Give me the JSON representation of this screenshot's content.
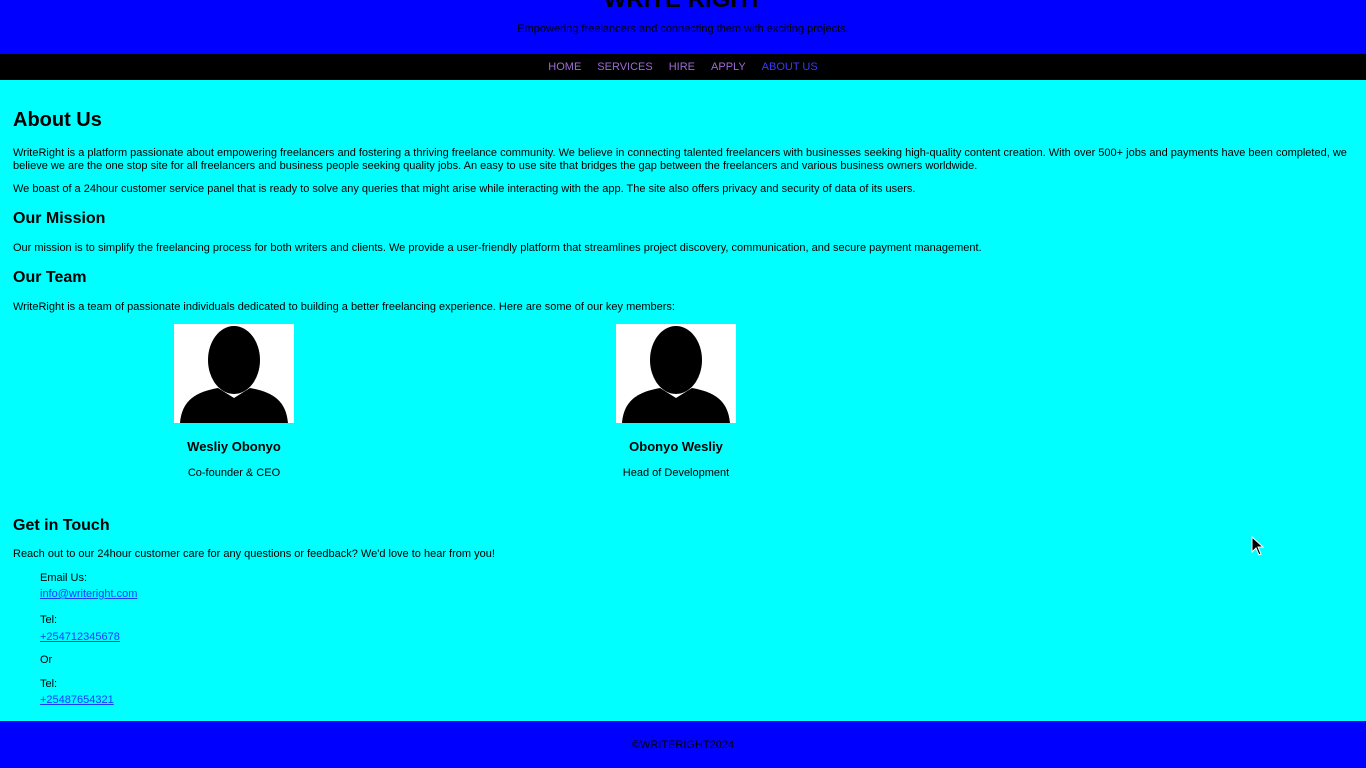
{
  "header": {
    "title": "WRITE RIGHT",
    "tagline": "Empowering freelancers and connecting them with exciting projects."
  },
  "nav": {
    "items": [
      {
        "label": "HOME"
      },
      {
        "label": "SERVICES"
      },
      {
        "label": "HIRE"
      },
      {
        "label": "APPLY"
      },
      {
        "label": "ABOUT US",
        "active": true
      }
    ]
  },
  "about": {
    "title": "About Us",
    "p1": "WriteRight is a platform passionate about empowering freelancers and fostering a thriving freelance community. We believe in connecting talented freelancers with businesses seeking high-quality content creation. With over 500+ jobs and payments have been completed, we believe we are the one stop site for all freelancers and business people seeking quality jobs. An easy to use site that bridges the gap between the freelancers and various business owners worldwide.",
    "p2": "We boast of a 24hour customer service panel that is ready to solve any queries that might arise while interacting with the app. The site also offers privacy and security of data of its users."
  },
  "mission": {
    "title": "Our Mission",
    "text": "Our mission is to simplify the freelancing process for both writers and clients. We provide a user-friendly platform that streamlines project discovery, communication, and secure payment management."
  },
  "team": {
    "title": "Our Team",
    "intro": "WriteRight is a team of passionate individuals dedicated to building a better freelancing experience. Here are some of our key members:",
    "members": [
      {
        "name": "Wesliy Obonyo",
        "role": "Co-founder & CEO"
      },
      {
        "name": "Obonyo Wesliy",
        "role": "Head of Development"
      }
    ]
  },
  "contact": {
    "title": "Get in Touch",
    "intro": "Reach out to our 24hour customer care for any questions or feedback? We'd love to hear from you!",
    "email_label": "Email Us:",
    "email": "info@writeright.com",
    "tel1_label": "Tel:",
    "tel1": "+254712345678",
    "or_label": "Or",
    "tel2_label": "Tel:",
    "tel2": "+25487654321"
  },
  "footer": {
    "text": "©WRITERIGHT2024"
  },
  "colors": {
    "header_bg": "#0000ff",
    "nav_bg": "#000000",
    "page_bg": "#00ffff",
    "nav_link": "#9c6cd6",
    "nav_active": "#3a3aff",
    "link": "#1a3cff"
  }
}
